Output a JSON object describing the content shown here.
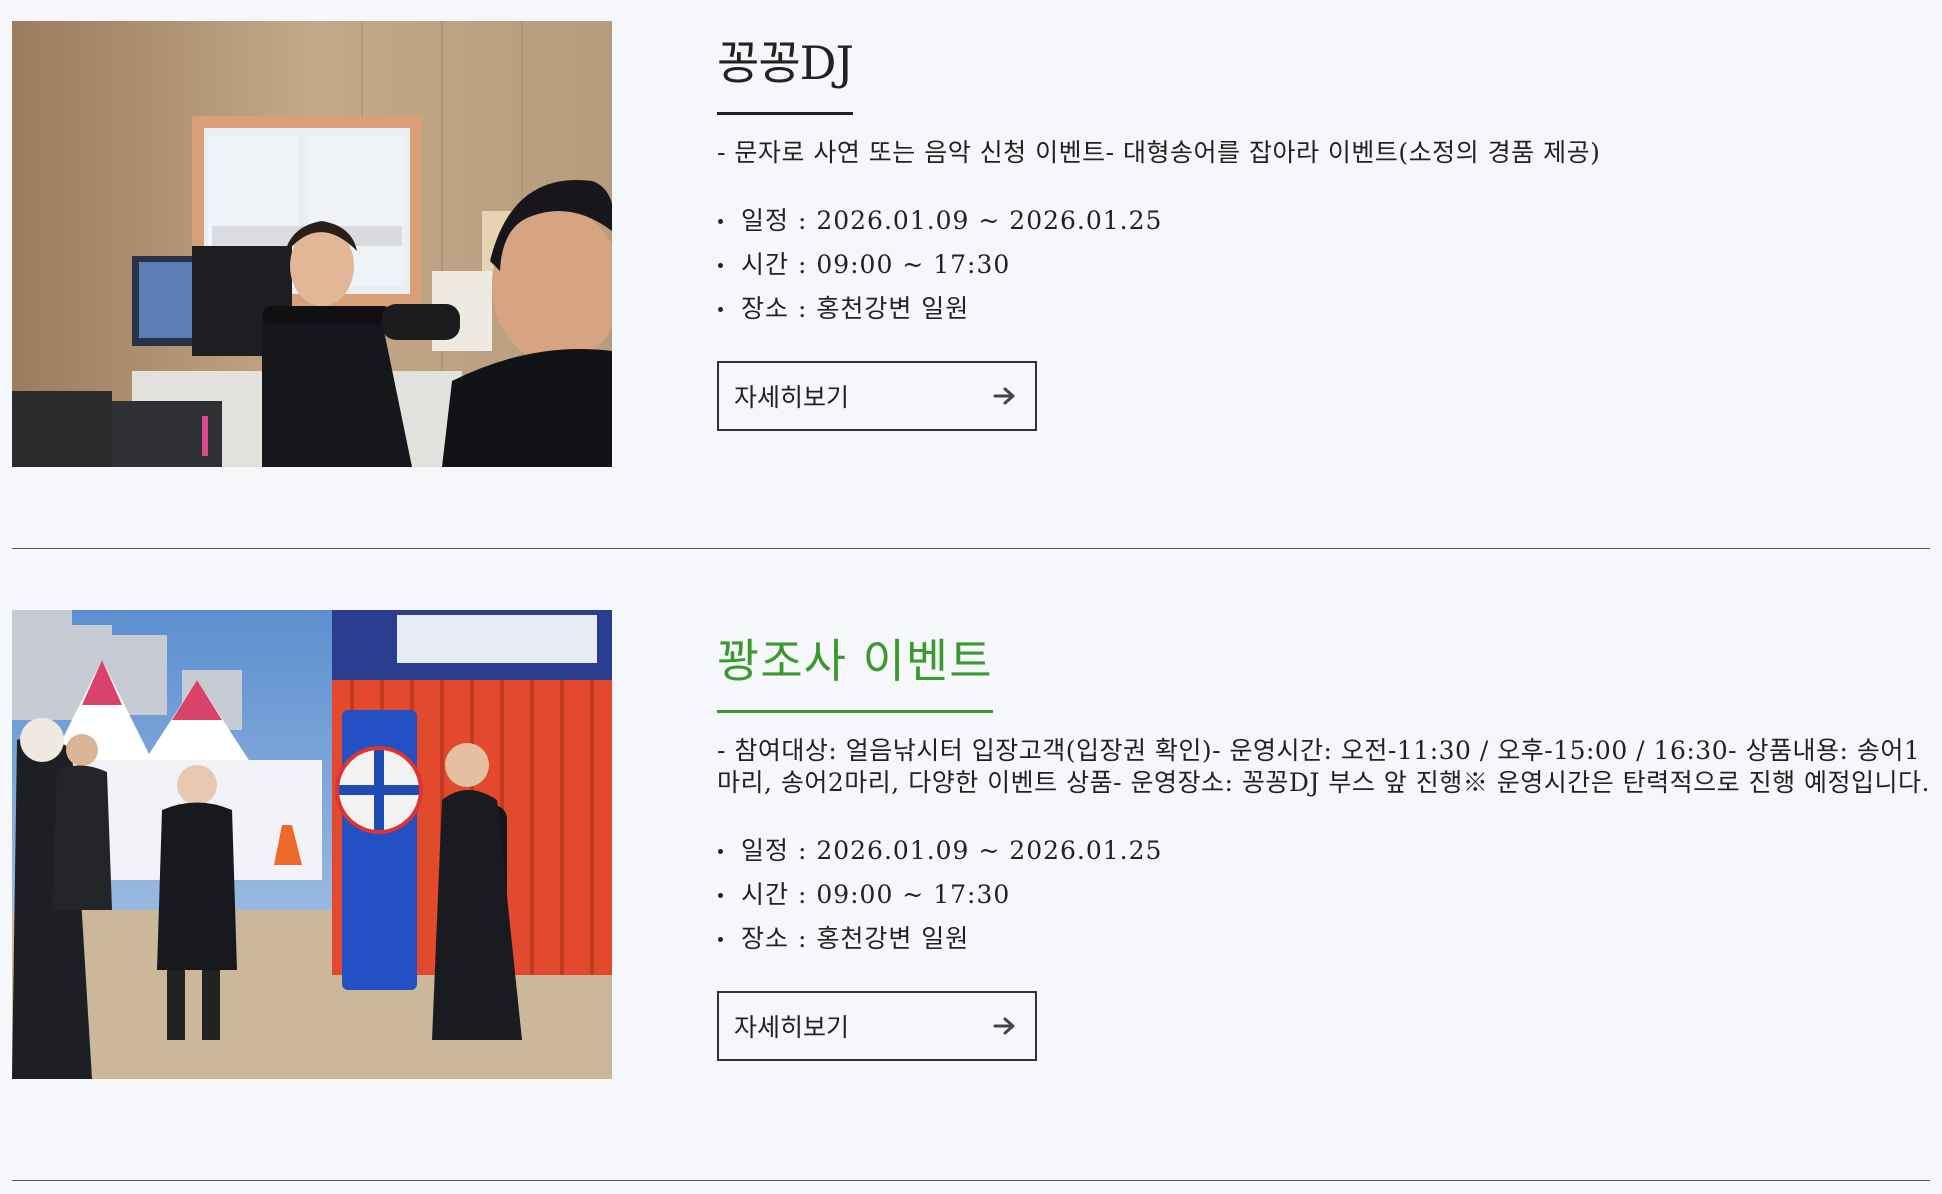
{
  "events": [
    {
      "title": "꽁꽁DJ",
      "description": "- 문자로 사연 또는 음악 신청 이벤트- 대형송어를 잡아라 이벤트(소정의 경품 제공)",
      "schedule": "일정 : 2026.01.09 ~ 2026.01.25",
      "time": "시간 : 09:00 ~ 17:30",
      "place": "장소 : 홍천강변 일원",
      "button_label": "자세히보기",
      "title_color": "#222222"
    },
    {
      "title": "꽝조사 이벤트",
      "description": "- 참여대상: 얼음낚시터 입장고객(입장권 확인)- 운영시간: 오전-11:30 / 오후-15:00 / 16:30- 상품내용: 송어1마리, 송어2마리, 다양한 이벤트 상품- 운영장소: 꽁꽁DJ 부스 앞 진행※ 운영시간은 탄력적으로 진행 예정입니다.",
      "schedule": "일정 : 2026.01.09 ~ 2026.01.25",
      "time": "시간 : 09:00 ~ 17:30",
      "place": "장소 : 홍천강변 일원",
      "button_label": "자세히보기",
      "title_color": "#3a9a2e"
    }
  ],
  "icons": {
    "button_arrow": "arrow-right-icon"
  },
  "colors": {
    "background": "#f5f7fb",
    "accent_green": "#3a9a2e",
    "text": "#222222"
  }
}
